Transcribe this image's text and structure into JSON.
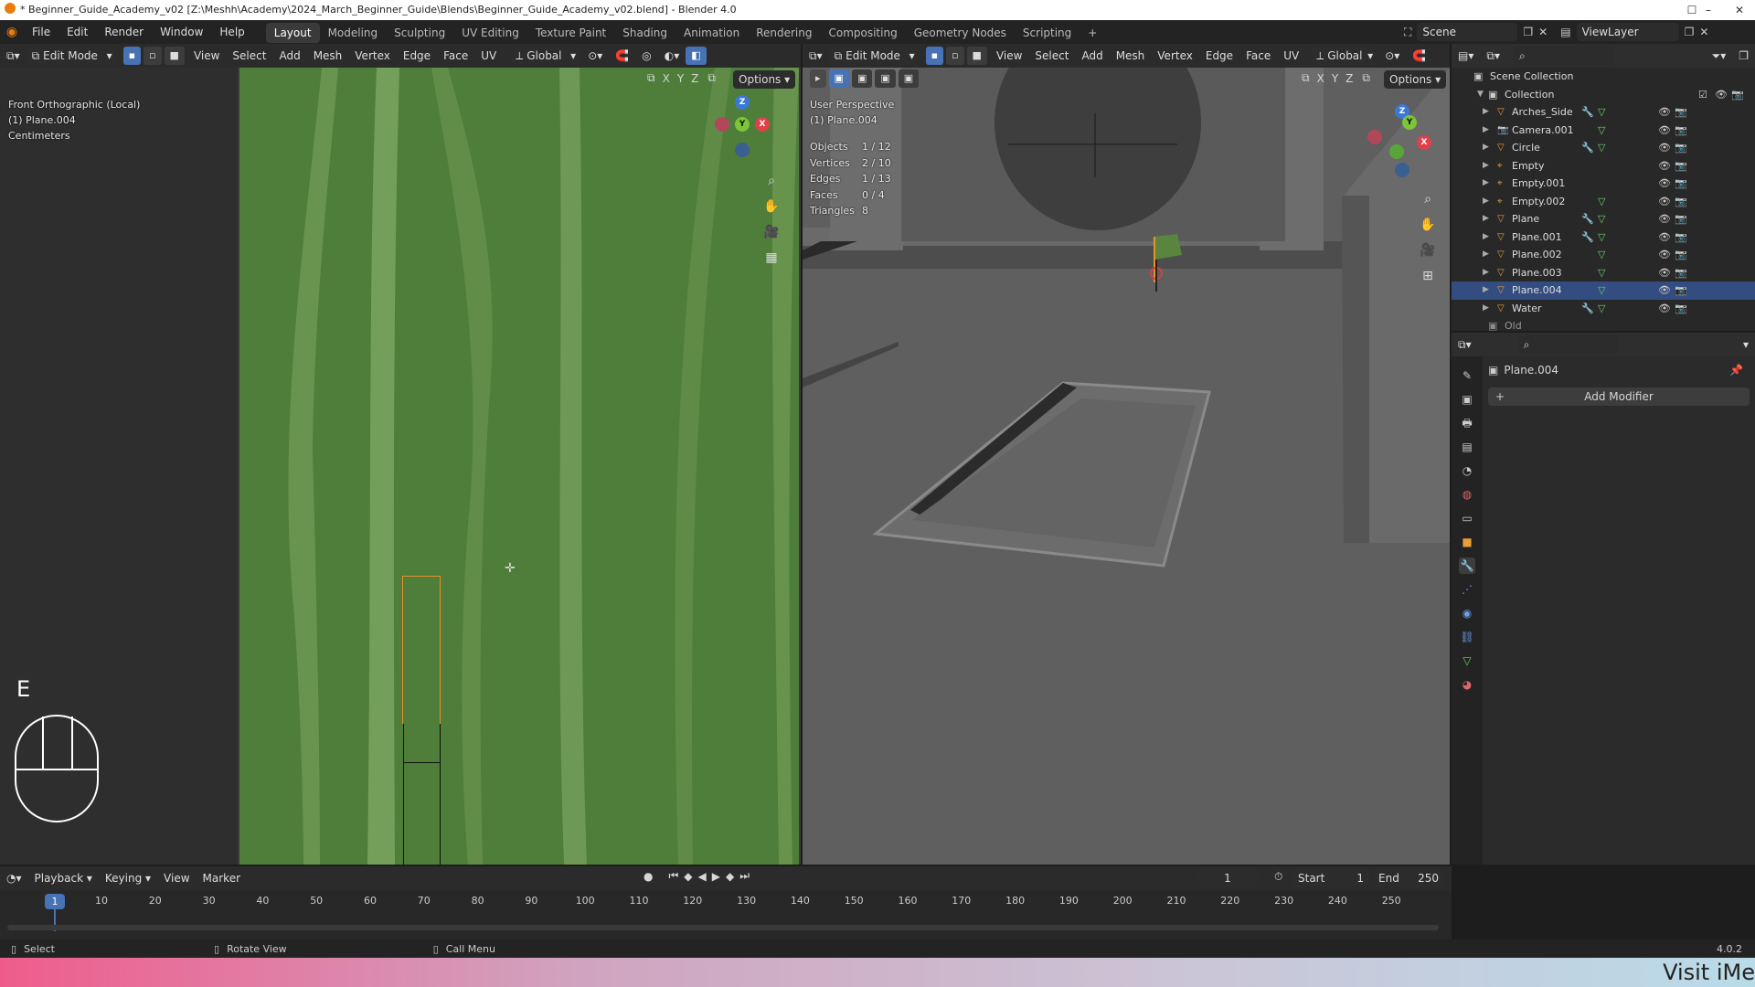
{
  "titlebar": {
    "text": "* Beginner_Guide_Academy_v02 [Z:\\Meshh\\Academy\\2024_March_Beginner_Guide\\Blends\\Beginner_Guide_Academy_v02.blend] - Blender 4.0"
  },
  "menu": [
    "File",
    "Edit",
    "Render",
    "Window",
    "Help"
  ],
  "workspaces": [
    "Layout",
    "Modeling",
    "Sculpting",
    "UV Editing",
    "Texture Paint",
    "Shading",
    "Animation",
    "Rendering",
    "Compositing",
    "Geometry Nodes",
    "Scripting"
  ],
  "active_workspace": "Layout",
  "scene": {
    "name": "Scene",
    "view_layer": "ViewLayer"
  },
  "uv_editor": {
    "mode": "Edit Mode",
    "menus": [
      "View",
      "Select",
      "Add",
      "Mesh",
      "Vertex",
      "Edge",
      "Face",
      "UV"
    ],
    "orientation": "Global",
    "view_name": "Front Orthographic (Local)",
    "object": "(1) Plane.004",
    "units": "Centimeters",
    "options": "Options",
    "axes": [
      "X",
      "Y",
      "Z"
    ]
  },
  "viewport": {
    "mode": "Edit Mode",
    "menus": [
      "View",
      "Select",
      "Add",
      "Mesh",
      "Vertex",
      "Edge",
      "Face",
      "UV"
    ],
    "orientation": "Global",
    "view_name": "User Perspective",
    "object": "(1) Plane.004",
    "options": "Options",
    "axes": [
      "X",
      "Y",
      "Z"
    ],
    "stats": [
      {
        "label": "Objects",
        "value": "1 / 12"
      },
      {
        "label": "Vertices",
        "value": "2 / 10"
      },
      {
        "label": "Edges",
        "value": "1 / 13"
      },
      {
        "label": "Faces",
        "value": "0 / 4"
      },
      {
        "label": "Triangles",
        "value": "8"
      }
    ]
  },
  "key_overlay": {
    "key": "E"
  },
  "outliner": {
    "root": "Scene Collection",
    "collection": "Collection",
    "items": [
      {
        "name": "Arches_Side",
        "icon": "mesh",
        "mod": true,
        "data": true
      },
      {
        "name": "Camera.001",
        "icon": "camera",
        "mod": false,
        "data": true
      },
      {
        "name": "Circle",
        "icon": "mesh",
        "mod": true,
        "data": true
      },
      {
        "name": "Empty",
        "icon": "empty",
        "mod": false,
        "data": false
      },
      {
        "name": "Empty.001",
        "icon": "empty",
        "mod": false,
        "data": false
      },
      {
        "name": "Empty.002",
        "icon": "empty",
        "mod": false,
        "data": true
      },
      {
        "name": "Plane",
        "icon": "mesh",
        "mod": true,
        "data": true
      },
      {
        "name": "Plane.001",
        "icon": "mesh",
        "mod": true,
        "data": true
      },
      {
        "name": "Plane.002",
        "icon": "mesh",
        "mod": false,
        "data": true
      },
      {
        "name": "Plane.003",
        "icon": "mesh",
        "mod": false,
        "data": true
      },
      {
        "name": "Plane.004",
        "icon": "mesh",
        "mod": false,
        "data": true
      },
      {
        "name": "Water",
        "icon": "mesh",
        "mod": true,
        "data": true
      }
    ],
    "selected": "Plane.004",
    "cut_item": "Old"
  },
  "properties": {
    "object": "Plane.004",
    "add_modifier": "Add Modifier"
  },
  "timeline": {
    "menus": [
      "Playback",
      "Keying",
      "View",
      "Marker"
    ],
    "current_frame": "1",
    "start_label": "Start",
    "start": "1",
    "end_label": "End",
    "end": "250",
    "ticks": [
      "10",
      "20",
      "30",
      "40",
      "50",
      "60",
      "70",
      "80",
      "90",
      "100",
      "110",
      "120",
      "130",
      "140",
      "150",
      "160",
      "170",
      "180",
      "190",
      "200",
      "210",
      "220",
      "230",
      "240",
      "250"
    ],
    "playhead": "1"
  },
  "statusbar": {
    "select": "Select",
    "rotate": "Rotate View",
    "menu": "Call Menu",
    "version": "4.0.2"
  },
  "banner": {
    "text": "Visit iMe"
  }
}
